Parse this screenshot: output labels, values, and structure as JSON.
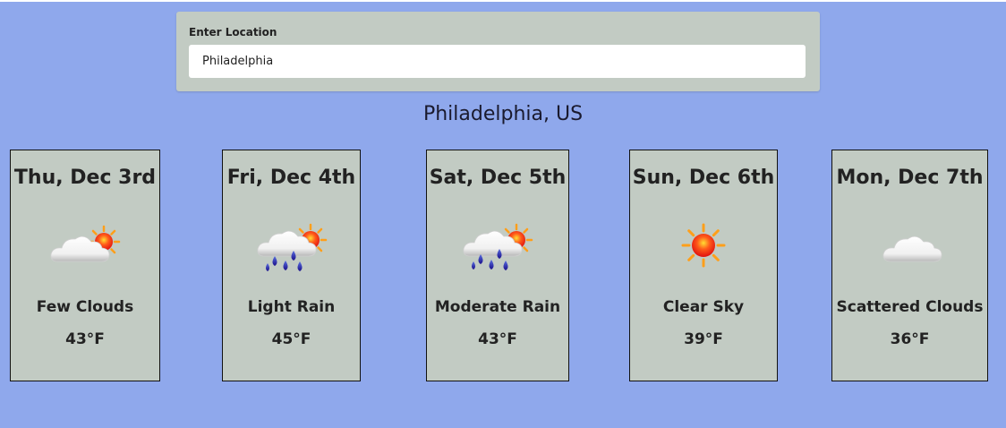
{
  "search": {
    "label": "Enter Location",
    "value": "Philadelphia"
  },
  "location": "Philadelphia, US",
  "forecast": [
    {
      "day": "Thu, Dec 3rd",
      "icon": "few-clouds-icon",
      "description": "Few Clouds",
      "temp": "43°F"
    },
    {
      "day": "Fri, Dec 4th",
      "icon": "light-rain-icon",
      "description": "Light Rain",
      "temp": "45°F"
    },
    {
      "day": "Sat, Dec 5th",
      "icon": "moderate-rain-icon",
      "description": "Moderate Rain",
      "temp": "43°F"
    },
    {
      "day": "Sun, Dec 6th",
      "icon": "clear-sky-icon",
      "description": "Clear Sky",
      "temp": "39°F"
    },
    {
      "day": "Mon, Dec 7th",
      "icon": "scattered-clouds-icon",
      "description": "Scattered Clouds",
      "temp": "36°F"
    }
  ],
  "colors": {
    "background": "#8fa8ec",
    "card": "#c2cbc3",
    "sun": "#ff9f1a",
    "rain": "#2a1fa8"
  }
}
